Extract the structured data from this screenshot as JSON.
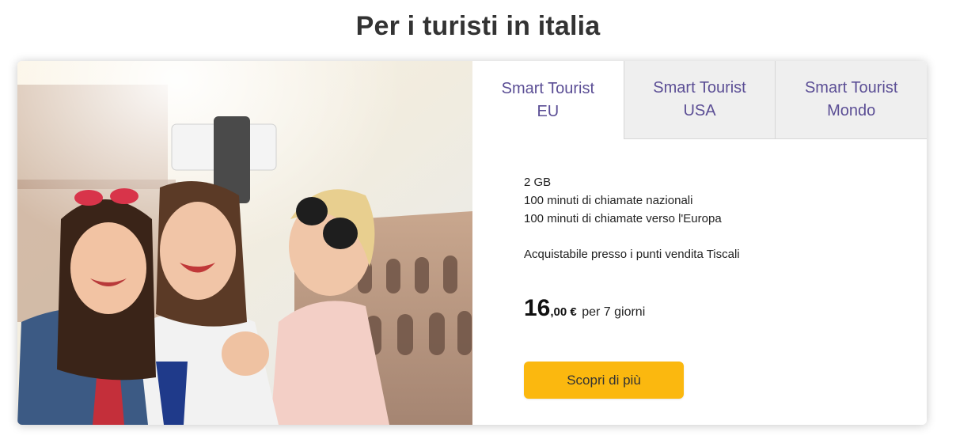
{
  "page": {
    "title": "Per i turisti in italia"
  },
  "tabs": [
    {
      "line1": "Smart Tourist",
      "line2": "EU",
      "active": true
    },
    {
      "line1": "Smart Tourist",
      "line2": "USA",
      "active": false
    },
    {
      "line1": "Smart Tourist",
      "line2": "Mondo",
      "active": false
    }
  ],
  "offer": {
    "features": [
      "2 GB",
      "100 minuti di chiamate nazionali",
      "100 minuti di chiamate verso l'Europa"
    ],
    "note": "Acquistabile presso i punti vendita Tiscali",
    "price_integer": "16",
    "price_decimal": ",00 €",
    "price_period": "per 7 giorni",
    "cta_label": "Scopri di più"
  },
  "colors": {
    "accent_purple": "#5b4e95",
    "cta_yellow": "#fbb80f",
    "tab_inactive_bg": "#efefef"
  }
}
